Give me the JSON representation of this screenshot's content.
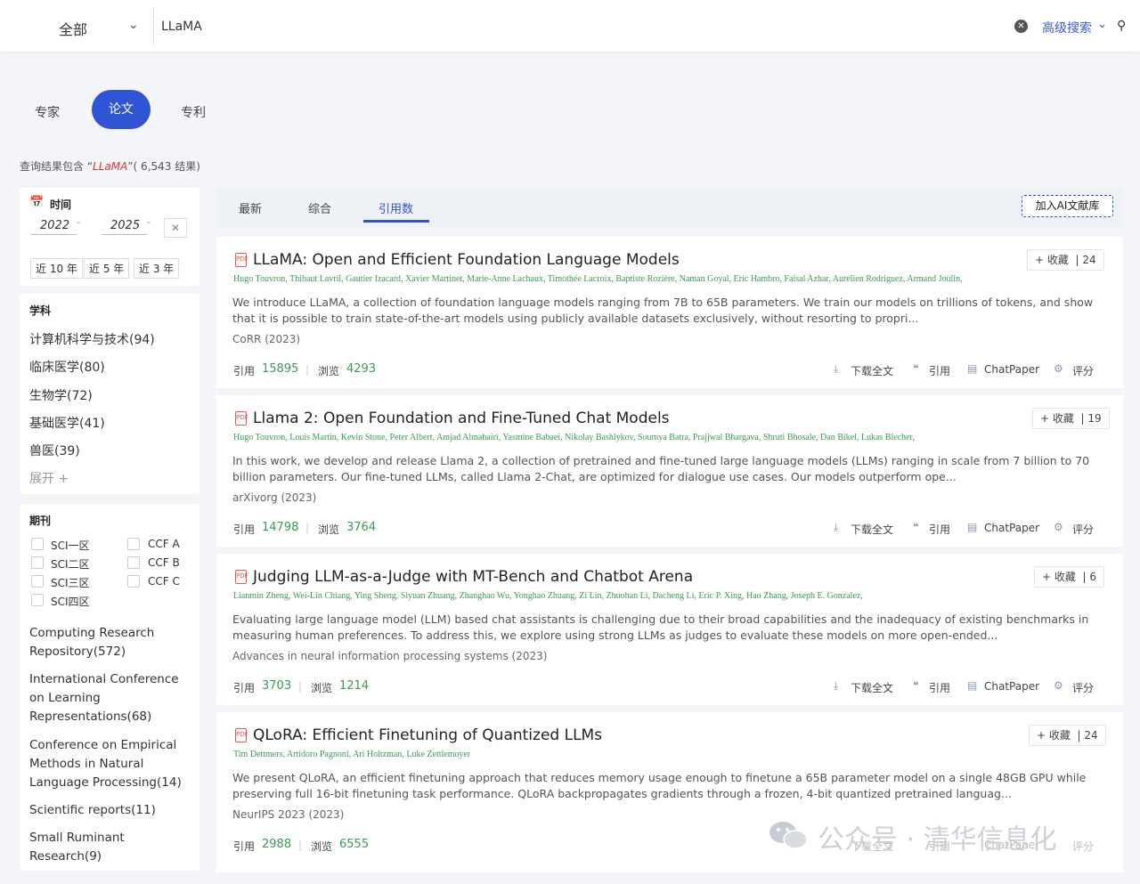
{
  "search": {
    "scope": "全部",
    "query": "LLaMA",
    "advanced_label": "高级搜索"
  },
  "type_tabs": [
    "专家",
    "论文",
    "专利"
  ],
  "result_summary": {
    "prefix": "查询结果包含 “",
    "keyword": "LLaMA",
    "suffix": "”( 6,543 结果)"
  },
  "sidebar": {
    "time_title": "时间",
    "year_from": "2022",
    "year_to": "2025",
    "clear": "✕",
    "quick_ranges": [
      "近 10 年",
      "近 5 年",
      "近 3 年"
    ],
    "subject_title": "学科",
    "subjects": [
      "计算机科学与技术(94)",
      "临床医学(80)",
      "生物学(72)",
      "基础医学(41)",
      "兽医(39)"
    ],
    "expand_label": "展开 +",
    "journal_title": "期刊",
    "journal_filters_left": [
      "SCI一区",
      "SCI二区",
      "SCI三区",
      "SCI四区"
    ],
    "journal_filters_right": [
      "CCF A",
      "CCF B",
      "CCF C"
    ],
    "venues": [
      "Computing Research Repository(572)",
      "International Conference on Learning Representations(68)",
      "Conference on Empirical Methods in Natural Language Processing(14)",
      "Scientific reports(11)",
      "Small Ruminant Research(9)"
    ]
  },
  "sort_tabs": [
    "最新",
    "综合",
    "引用数"
  ],
  "ai_button": "加入AI文献库",
  "actions": {
    "download": "下载全文",
    "cite": "引用",
    "chatpaper": "ChatPaper",
    "rate": "评分",
    "cite_label": "引用",
    "view_label": "浏览",
    "fav_label": "+ 收藏"
  },
  "papers": [
    {
      "title": "LLaMA: Open and Efficient Foundation Language Models",
      "authors": "Hugo Touvron,  Thibaut Lavril,  Gautier Izacard,  Xavier Martinet,  Marie-Anne Lachaux,  Timothée Lacroix,  Baptiste Rozière,  Naman Goyal,  Eric Hambro,  Faisal Azhar,  Aurelien Rodriguez,  Armand Joulin,",
      "abstract": "We introduce LLaMA, a collection of foundation language models ranging from 7B to 65B parameters. We train our models on trillions of tokens, and show that it is possible to train state-of-the-art models using publicly available datasets exclusively, without resorting to propri...",
      "venue": "CoRR (2023)",
      "citations": "15895",
      "views": "4293",
      "fav_count": "| 24"
    },
    {
      "title": "Llama 2: Open Foundation and Fine-Tuned Chat Models",
      "authors": "Hugo Touvron,  Louis Martin,  Kevin Stone,  Peter Albert,  Amjad Almahairi,  Yasmine Babaei,  Nikolay Bashlykov,  Soumya Batra,  Prajjwal Bhargava,  Shruti Bhosale,  Dan Bikel,  Lukas Blecher,",
      "abstract": "In this work, we develop and release Llama 2, a collection of pretrained and fine-tuned large language models (LLMs) ranging in scale from 7 billion to 70 billion parameters. Our fine-tuned LLMs, called Llama 2-Chat, are optimized for dialogue use cases. Our models outperform ope...",
      "venue": "arXivorg (2023)",
      "citations": "14798",
      "views": "3764",
      "fav_count": "| 19"
    },
    {
      "title": "Judging LLM-as-a-Judge with MT-Bench and Chatbot Arena",
      "authors": "Lianmin Zheng,  Wei-Lin Chiang,  Ying Sheng,  Siyuan Zhuang,  Zhanghao Wu,  Yonghao Zhuang,  Zi Lin,  Zhuohan Li,  Dacheng Li,  Eric P. Xing,  Hao Zhang,  Joseph E. Gonzalez,",
      "abstract": "Evaluating large language model (LLM) based chat assistants is challenging due to their broad capabilities and the inadequacy of existing benchmarks in measuring human preferences. To address this, we explore using strong LLMs as judges to evaluate these models on more open-ended...",
      "venue": "Advances in neural information processing systems  (2023)",
      "citations": "3703",
      "views": "1214",
      "fav_count": "| 6"
    },
    {
      "title": "QLoRA: Efficient Finetuning of Quantized LLMs",
      "authors": "Tim Dettmers,  Artidoro Pagnoni,  Ari Holtzman,  Luke Zettlemoyer",
      "abstract": "We present QLoRA, an efficient finetuning approach that reduces memory usage enough to finetune a 65B parameter model on a single 48GB GPU while preserving full 16-bit finetuning task performance. QLoRA backpropagates gradients through a frozen, 4-bit quantized pretrained languag...",
      "venue": "NeurIPS 2023 (2023)",
      "citations": "2988",
      "views": "6555",
      "fav_count": "| 24"
    }
  ],
  "watermark": "公众号 · 清华信息化"
}
